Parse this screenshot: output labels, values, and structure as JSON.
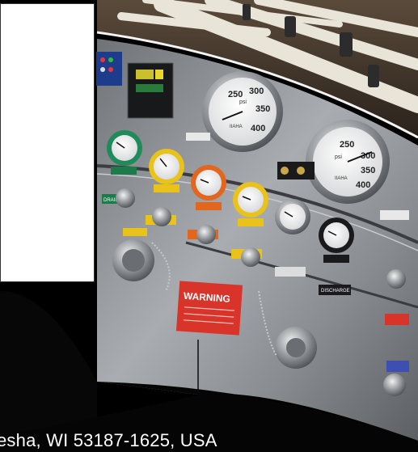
{
  "address": {
    "text": "esha, WI 53187-1625, USA"
  },
  "gauges": {
    "large_left": {
      "labels": [
        "250",
        "300",
        "350",
        "400"
      ],
      "unit": "psi"
    },
    "large_right": {
      "labels": [
        "250",
        "300",
        "350",
        "400"
      ],
      "unit": "psi"
    },
    "dial_brand": "IIAHA"
  },
  "panel_labels": {
    "warning": "WARNING",
    "discharge": "DISCHARGE",
    "drain": "DRAIN"
  },
  "colors": {
    "panel_steel": "#8c8f93",
    "gauge_green": "#1f8a5a",
    "gauge_yellow": "#e9c21a",
    "gauge_orange": "#e2661e",
    "warning_red": "#d8342a",
    "label_green": "#1e7a4a",
    "frame_dark": "#1a1a1c"
  }
}
